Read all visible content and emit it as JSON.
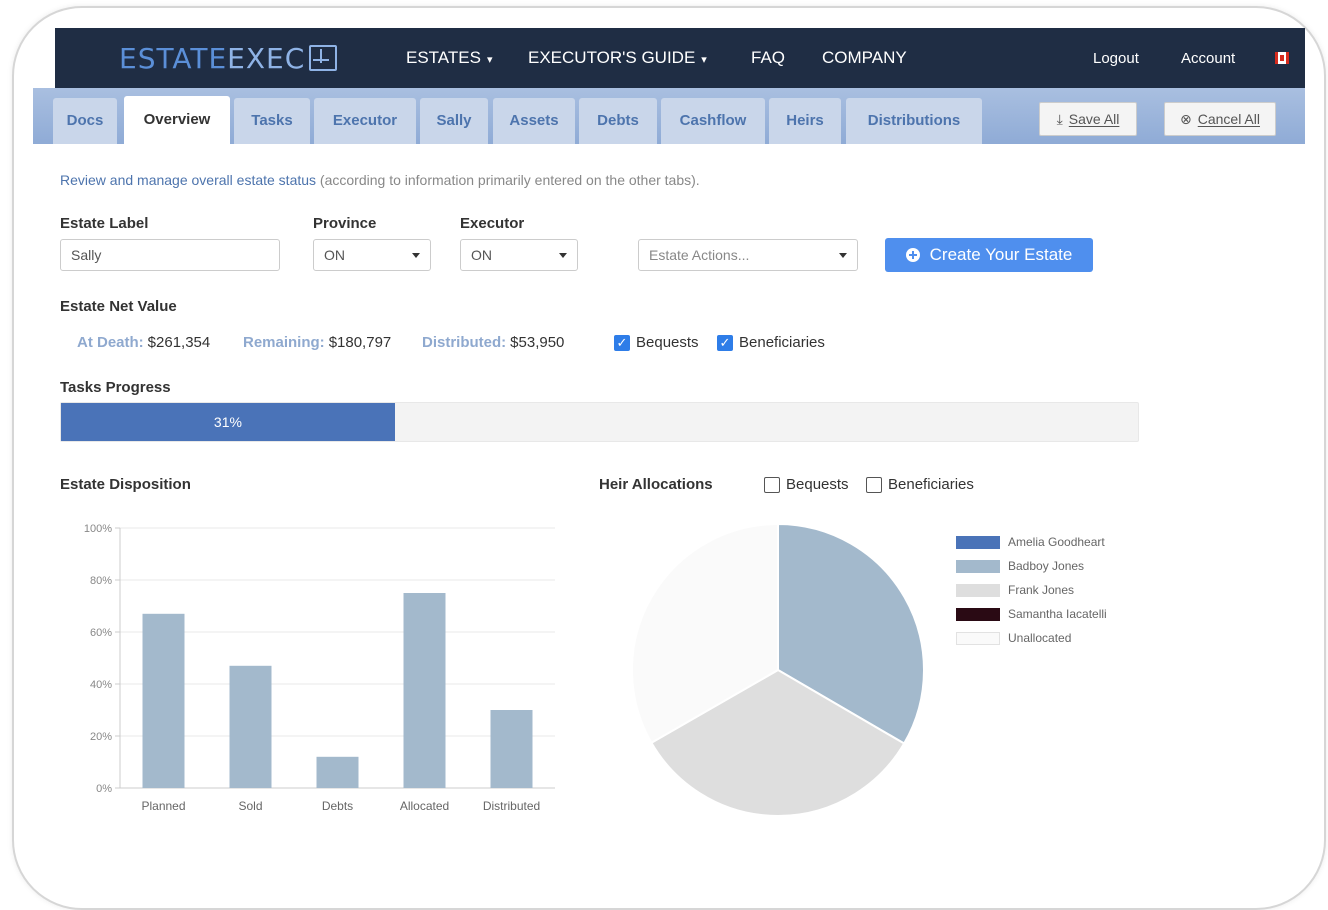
{
  "nav": {
    "logo_left": "ESTATE",
    "logo_right": "EXEC",
    "items": [
      {
        "label": "ESTATES",
        "caret": "▾"
      },
      {
        "label": "EXECUTOR'S GUIDE",
        "caret": "▾"
      },
      {
        "label": "FAQ"
      },
      {
        "label": "COMPANY"
      }
    ],
    "logout": "Logout",
    "account": "Account",
    "flag_icon": "canada-flag-icon"
  },
  "tabs": [
    {
      "label": "Docs"
    },
    {
      "label": "Overview",
      "active": true
    },
    {
      "label": "Tasks"
    },
    {
      "label": "Executor"
    },
    {
      "label": "Sally"
    },
    {
      "label": "Assets"
    },
    {
      "label": "Debts"
    },
    {
      "label": "Cashflow"
    },
    {
      "label": "Heirs"
    },
    {
      "label": "Distributions"
    }
  ],
  "toolbar": {
    "save_all": "Save All",
    "cancel_all": "Cancel All"
  },
  "intro": {
    "link": "Review and manage overall estate status",
    "rest": " (according to information primarily entered on the other tabs)."
  },
  "form": {
    "estate_label": "Estate Label",
    "estate_value": "Sally",
    "province_label": "Province",
    "province_value": "ON",
    "executor_label": "Executor",
    "executor_value": "ON",
    "actions_placeholder": "Estate Actions...",
    "create_button": "Create Your Estate"
  },
  "net_value": {
    "title": "Estate Net Value",
    "at_death_label": "At Death:",
    "at_death": "$261,354",
    "remaining_label": "Remaining:",
    "remaining": "$180,797",
    "distributed_label": "Distributed:",
    "distributed": "$53,950",
    "bequests": "Bequests",
    "beneficiaries": "Beneficiaries"
  },
  "progress": {
    "title": "Tasks Progress",
    "value": 31,
    "text": "31%"
  },
  "disposition": {
    "title": "Estate Disposition"
  },
  "heir": {
    "title": "Heir Allocations",
    "bequests": "Bequests",
    "beneficiaries": "Beneficiaries"
  },
  "colors": {
    "accent": "#4f8fee",
    "bar": "#a3b9cc",
    "navbar": "#1f2d44"
  },
  "chart_data": [
    {
      "type": "bar",
      "categories": [
        "Planned",
        "Sold",
        "Debts",
        "Allocated",
        "Distributed"
      ],
      "values": [
        67,
        47,
        12,
        75,
        30
      ],
      "yticks": [
        "0%",
        "20%",
        "40%",
        "60%",
        "80%",
        "100%"
      ],
      "ylim": [
        0,
        100
      ],
      "grid": true,
      "color": "#a3b9cc"
    },
    {
      "type": "pie",
      "labels": [
        "Amelia Goodheart",
        "Badboy Jones",
        "Frank Jones",
        "Samantha Iacatelli",
        "Unallocated"
      ],
      "values": [
        0,
        33.4,
        33.3,
        0,
        33.3
      ],
      "colors": [
        "#4a73b8",
        "#a3b9cc",
        "#dedede",
        "#2a0a14",
        "#fafafa"
      ],
      "legend": "right"
    }
  ]
}
